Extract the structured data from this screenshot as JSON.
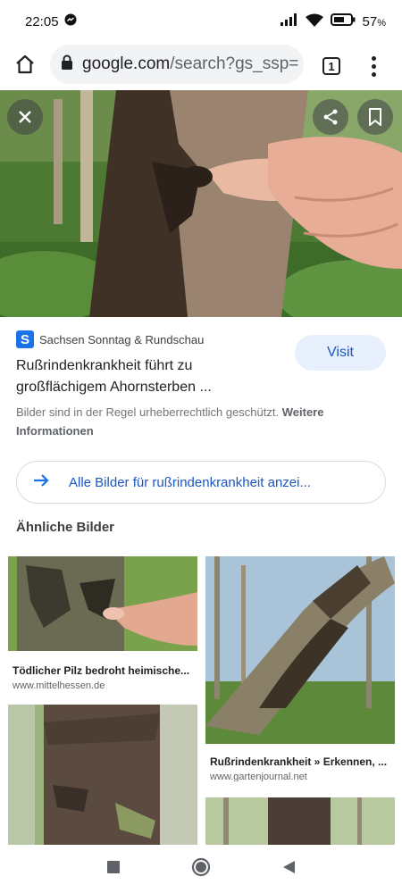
{
  "status": {
    "time": "22:05",
    "battery": "57"
  },
  "browser": {
    "domain": "google.com",
    "path": "/search?gs_ssp=",
    "tab_count": "1"
  },
  "result": {
    "source_name": "Sachsen Sonntag & Rundschau",
    "favicon_letter": "S",
    "visit_label": "Visit",
    "title_line1": "Rußrindenkrankheit führt zu",
    "title_line2": "großflächigem Ahornsterben ...",
    "copyright_text": "Bilder sind in der Regel urheberrechtlich geschützt.",
    "copyright_more": "Weitere Informationen"
  },
  "all_images_label": "Alle Bilder für rußrindenkrankheit anzei...",
  "similar_heading": "Ähnliche Bilder",
  "similar": [
    {
      "caption": "Tödlicher Pilz bedroht heimische...",
      "domain": "www.mittelhessen.de"
    },
    {
      "caption": "Rußrindenkrankheit » Erkennen, ...",
      "domain": "www.gartenjournal.net"
    }
  ],
  "icons": {
    "home": "home-icon",
    "lock": "lock-icon",
    "menu": "more-vert-icon",
    "close": "close-icon",
    "share": "share-icon",
    "bookmark": "bookmark-icon",
    "arrow": "arrow-right-icon",
    "nav_recent": "square-icon",
    "nav_home": "circle-icon",
    "nav_back": "triangle-back-icon"
  },
  "colors": {
    "accent": "#1a73e8",
    "link": "#1a56c4",
    "visit_bg": "#e8f0fe"
  }
}
